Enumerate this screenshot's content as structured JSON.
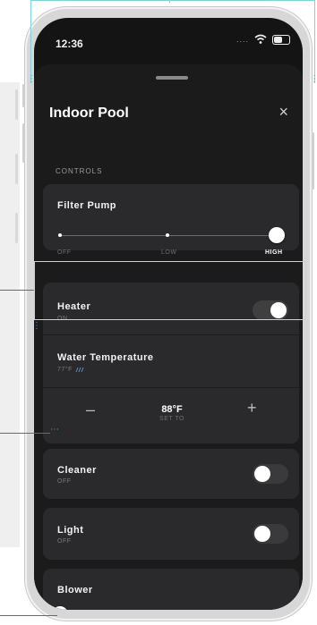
{
  "status_bar": {
    "time": "12:36",
    "signal": "....",
    "wifi_icon": "wifi-icon",
    "battery_icon": "battery-icon"
  },
  "header": {
    "title": "Indoor Pool",
    "close_label": "×"
  },
  "controls": {
    "section_label": "CONTROLS",
    "filter_pump": {
      "title": "Filter Pump",
      "levels": [
        "OFF",
        "LOW",
        "HIGH"
      ],
      "selected": "HIGH"
    },
    "heater": {
      "title": "Heater",
      "status": "ON",
      "on": true
    },
    "water_temperature": {
      "title": "Water Temperature",
      "current": "77°F",
      "setpoint": "88°F",
      "set_label": "SET TO",
      "minus_label": "–",
      "plus_label": "+"
    },
    "cleaner": {
      "title": "Cleaner",
      "status": "OFF",
      "on": false
    },
    "light": {
      "title": "Light",
      "status": "OFF",
      "on": false
    },
    "blower": {
      "title": "Blower"
    }
  },
  "colors": {
    "background": "#1b1b1b",
    "card": "#2a2a2c",
    "accent": "#ffffff",
    "annotation": "#7fd3d8"
  }
}
